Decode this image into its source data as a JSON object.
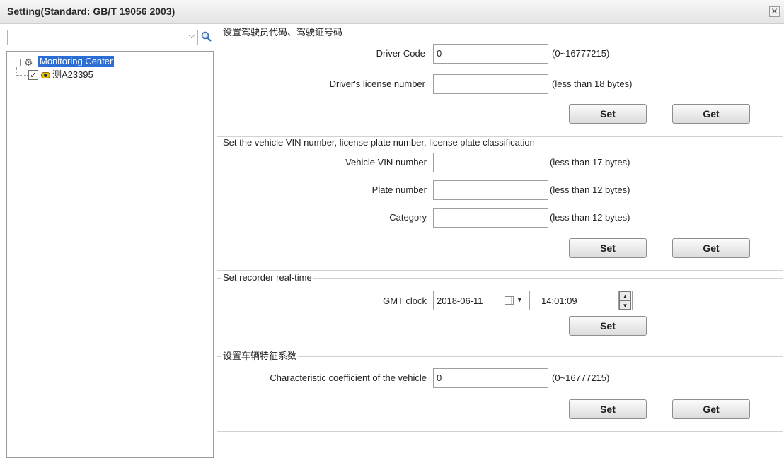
{
  "window": {
    "title": "Setting(Standard: GB/T 19056 2003)",
    "close_glyph": "✕"
  },
  "left_panel": {
    "search_value": "",
    "dropdown_glyph": "⌵",
    "tree": {
      "expand_glyph": "−",
      "root_label": "Monitoring Center",
      "child_label": "测A23395",
      "child_checked": true,
      "check_glyph": "✓"
    }
  },
  "driver_section": {
    "title": "设置驾驶员代码、驾驶证号码",
    "driver_code_label": "Driver Code",
    "driver_code_value": "0",
    "driver_code_hint": "(0~16777215)",
    "license_label": "Driver's license number",
    "license_value": "",
    "license_hint": "(less than 18 bytes)",
    "set_label": "Set",
    "get_label": "Get"
  },
  "vehicle_section": {
    "title": "Set the vehicle VIN number, license plate number, license plate classification",
    "vin_label": "Vehicle VIN number",
    "vin_value": "",
    "vin_hint": "(less than 17 bytes)",
    "plate_label": "Plate number",
    "plate_value": "",
    "plate_hint": "(less than 12 bytes)",
    "category_label": "Category",
    "category_value": "",
    "category_hint": "(less than 12 bytes)",
    "set_label": "Set",
    "get_label": "Get"
  },
  "recorder_section": {
    "title": "Set recorder real-time",
    "gmt_label": "GMT clock",
    "date_value": "2018-06-11",
    "time_value": "14:01:09",
    "set_label": "Set",
    "up_glyph": "▲",
    "down_glyph": "▼",
    "cal_arrow_glyph": "▼"
  },
  "coefficient_section": {
    "title": "设置车辆特征系数",
    "coef_label": "Characteristic coefficient of the vehicle",
    "coef_value": "0",
    "coef_hint": "(0~16777215)",
    "set_label": "Set",
    "get_label": "Get"
  }
}
